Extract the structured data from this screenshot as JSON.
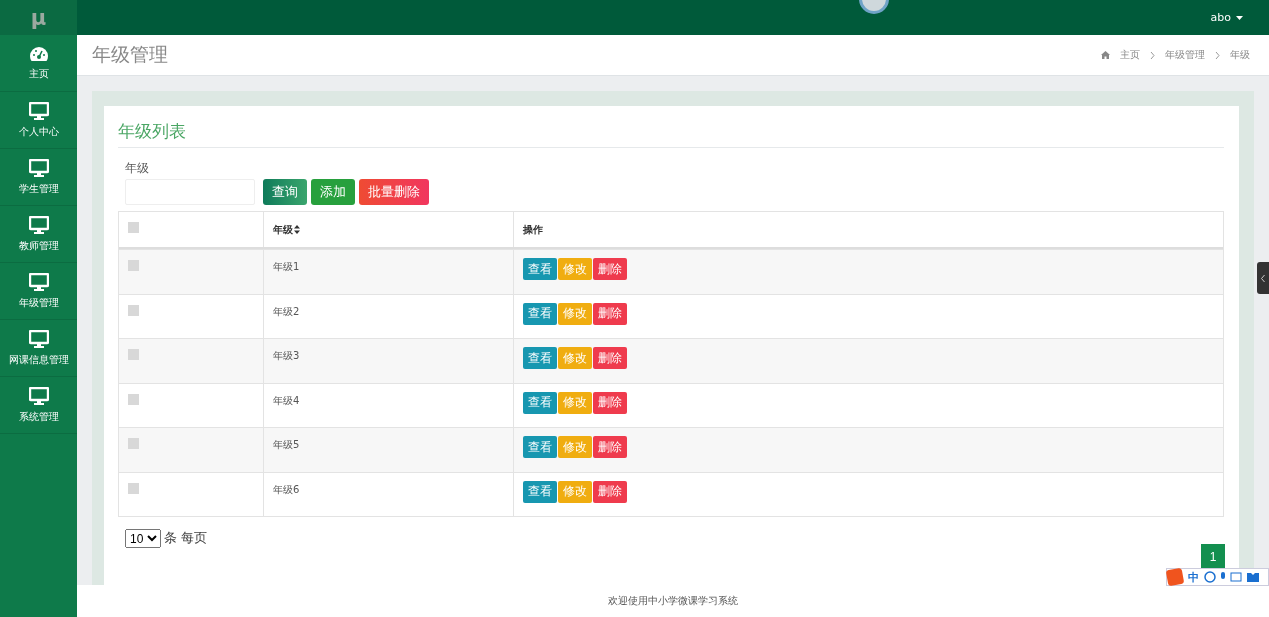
{
  "brand": "μ",
  "user": {
    "name": "abo"
  },
  "sidebar": {
    "items": [
      {
        "label": "主页",
        "kind": "dashboard"
      },
      {
        "label": "个人中心",
        "kind": "monitor"
      },
      {
        "label": "学生管理",
        "kind": "monitor"
      },
      {
        "label": "教师管理",
        "kind": "monitor"
      },
      {
        "label": "年级管理",
        "kind": "monitor"
      },
      {
        "label": "网课信息管理",
        "kind": "monitor"
      },
      {
        "label": "系统管理",
        "kind": "monitor"
      }
    ]
  },
  "page_title": "年级管理",
  "breadcrumb": [
    "主页",
    "年级管理",
    "年级"
  ],
  "card": {
    "title": "年级列表",
    "search": {
      "label": "年级"
    },
    "buttons": [
      {
        "label": "查询",
        "kind": "search"
      },
      {
        "label": "添加",
        "kind": "add"
      },
      {
        "label": "批量删除",
        "kind": "delete"
      }
    ],
    "table": {
      "columns": [
        {
          "kind": "checkbox",
          "checked": false
        },
        {
          "kind": "sortable",
          "label": "年级"
        },
        {
          "kind": "text",
          "label": "操作"
        }
      ],
      "rows": [
        {
          "checked": false,
          "grade": "年级1",
          "actions": [
            {
              "label": "查看",
              "kind": "view"
            },
            {
              "label": "修改",
              "kind": "edit"
            },
            {
              "label": "删除",
              "kind": "delete"
            }
          ]
        },
        {
          "checked": false,
          "grade": "年级2",
          "actions": [
            {
              "label": "查看",
              "kind": "view"
            },
            {
              "label": "修改",
              "kind": "edit"
            },
            {
              "label": "删除",
              "kind": "delete"
            }
          ]
        },
        {
          "checked": false,
          "grade": "年级3",
          "actions": [
            {
              "label": "查看",
              "kind": "view"
            },
            {
              "label": "修改",
              "kind": "edit"
            },
            {
              "label": "删除",
              "kind": "delete"
            }
          ]
        },
        {
          "checked": false,
          "grade": "年级4",
          "actions": [
            {
              "label": "查看",
              "kind": "view"
            },
            {
              "label": "修改",
              "kind": "edit"
            },
            {
              "label": "删除",
              "kind": "delete"
            }
          ]
        },
        {
          "checked": false,
          "grade": "年级5",
          "actions": [
            {
              "label": "查看",
              "kind": "view"
            },
            {
              "label": "修改",
              "kind": "edit"
            },
            {
              "label": "删除",
              "kind": "delete"
            }
          ]
        },
        {
          "checked": false,
          "grade": "年级6",
          "actions": [
            {
              "label": "查看",
              "kind": "view"
            },
            {
              "label": "修改",
              "kind": "edit"
            },
            {
              "label": "删除",
              "kind": "delete"
            }
          ]
        }
      ]
    },
    "page_size": {
      "value": "10",
      "suffix": "条 每页"
    },
    "pagination": [
      {
        "label": "1",
        "selected": true
      }
    ]
  },
  "ime_bar": {
    "label": "中"
  },
  "footer": "欢迎使用中小学微课学习系统"
}
